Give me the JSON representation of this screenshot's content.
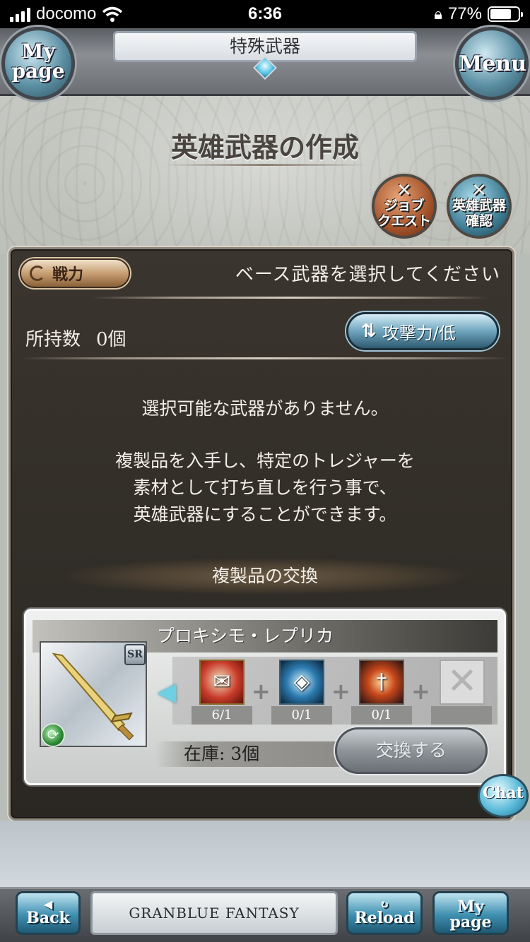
{
  "status_bar": {
    "carrier": "docomo",
    "time": "6:36",
    "battery": "77%",
    "battery_level": 0.77
  },
  "header": {
    "title": "特殊武器",
    "mypage_label_1": "My",
    "mypage_label_2": "page",
    "menu_label": "Menu"
  },
  "page_heading": "英雄武器の作成",
  "action_buttons": {
    "job_quest_line1": "ジョブ",
    "job_quest_line2": "クエスト",
    "hero_confirm_line1": "英雄武器",
    "hero_confirm_line2": "確認"
  },
  "panel": {
    "power_label": "戦力",
    "prompt": "ベース武器を選択してください",
    "owned_label": "所持数",
    "owned_value": "0個",
    "sort_label": "攻撃力/低",
    "empty_line1": "選択可能な武器がありません。",
    "info_line1": "複製品を入手し、特定のトレジャーを",
    "info_line2": "素材として打ち直しを行う事で、",
    "info_line3": "英雄武器にすることができます。",
    "exchange_heading": "複製品の交換"
  },
  "replica_card": {
    "name": "プロキシモ・レプリカ",
    "rarity": "SR",
    "materials": [
      {
        "icon": "scroll-icon",
        "count": "6/1"
      },
      {
        "icon": "orb-icon",
        "count": "0/1"
      },
      {
        "icon": "daggers-icon",
        "count": "0/1"
      },
      {
        "icon": "empty-slot-icon",
        "count": ""
      }
    ],
    "stock": "在庫: 3個",
    "exchange_label": "交換する"
  },
  "chat_label": "Chat",
  "bottom_bar": {
    "back_label": "Back",
    "logo_text": "GRANBLUE FANTASY",
    "reload_label": "Reload",
    "mypage_label_1": "My",
    "mypage_label_2": "page"
  }
}
